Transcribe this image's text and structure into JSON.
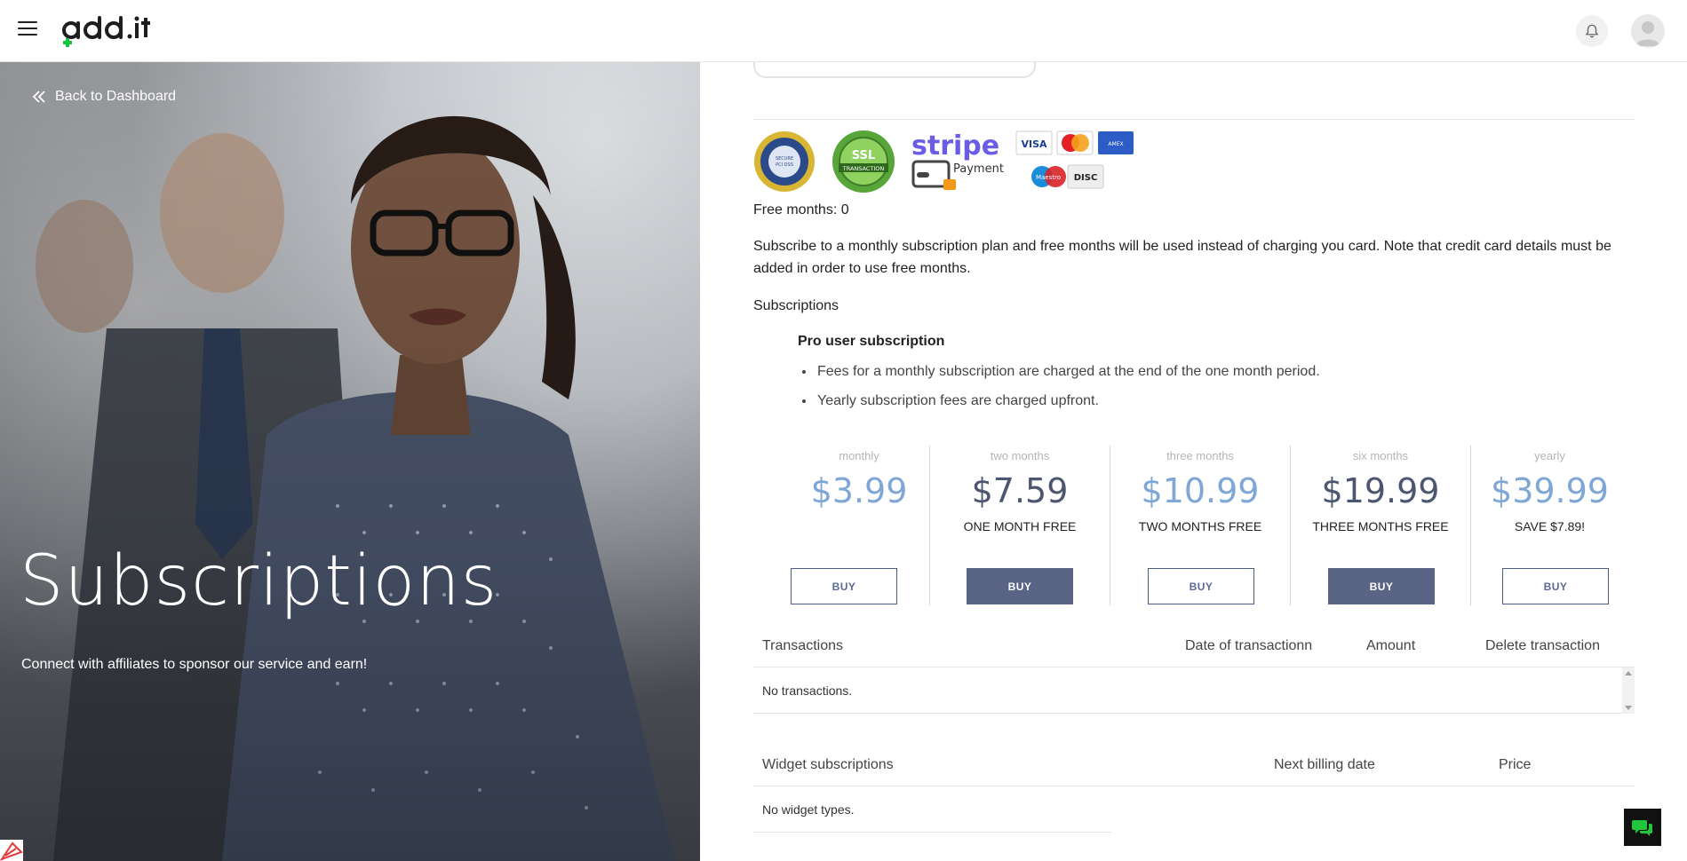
{
  "header": {
    "logo_text": "add.it",
    "menu_icon": "hamburger-icon",
    "notification_icon": "bell-icon",
    "avatar_icon": "user-avatar-icon"
  },
  "hero": {
    "back_label": "Back to Dashboard",
    "title": "Subscriptions",
    "subtitle": "Connect with affiliates to sponsor our service and earn!"
  },
  "badges": {
    "secure_seal_text": "SECURE SHOPPING PCI DSS COMPLIANT",
    "ssl_text": "SSL TRANSACTION",
    "stripe_text": "stripe",
    "stripe_payment": "Payment",
    "cards": [
      "VISA",
      "MasterCard",
      "AMERICAN EXPRESS",
      "Maestro",
      "DISC"
    ]
  },
  "free_months": "Free months: 0",
  "note": "Subscribe to a monthly subscription plan and free months will be used instead of charging you card. Note that credit card details must be added in order to use free months.",
  "subscriptions_heading": "Subscriptions",
  "pro": {
    "title": "Pro user subscription",
    "bullets": [
      "Fees for a monthly subscription are charged at the end of the one month period.",
      "Yearly subscription fees are charged upfront."
    ]
  },
  "plans": [
    {
      "period": "monthly",
      "price": "$3.99",
      "promo": "",
      "buy": "BUY"
    },
    {
      "period": "two months",
      "price": "$7.59",
      "promo": "ONE MONTH FREE",
      "buy": "BUY"
    },
    {
      "period": "three months",
      "price": "$10.99",
      "promo": "TWO MONTHS FREE",
      "buy": "BUY"
    },
    {
      "period": "six months",
      "price": "$19.99",
      "promo": "THREE MONTHS FREE",
      "buy": "BUY"
    },
    {
      "period": "yearly",
      "price": "$39.99",
      "promo": "SAVE $7.89!",
      "buy": "BUY"
    }
  ],
  "transactions": {
    "headers": [
      "Transactions",
      "Date of transactionn",
      "Amount",
      "Delete transaction"
    ],
    "empty": "No transactions."
  },
  "widgets": {
    "headers": [
      "Widget subscriptions",
      "Next billing date",
      "Price"
    ],
    "empty": "No widget types."
  },
  "chat_icon": "chat-bubbles-icon"
}
